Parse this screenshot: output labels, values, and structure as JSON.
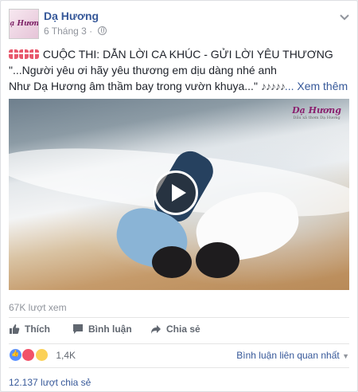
{
  "post": {
    "page_name": "Dạ Hương",
    "date": "6 Tháng 3 ·",
    "avatar_logo": "Dạ Hương",
    "line1": "CUỘC THI: DẪN LỜI CA KHÚC - GỬI LỜI YÊU THƯƠNG",
    "line2": "\"...Người yêu ơi hãy yêu thương em dịu dàng nhé anh",
    "line3": "Như Dạ Hương âm thầm bay trong vườn khuya...\"",
    "notes": "♪♪♪♪♪",
    "see_more": "... Xem thêm",
    "icons": [
      "gift-icon",
      "globe-icon",
      "chevron-down-icon",
      "play-icon",
      "like-icon",
      "comment-icon",
      "share-icon"
    ]
  },
  "media": {
    "logo": "Dạ Hương",
    "logo_sub": "Dầu xả thơm Dạ Hương"
  },
  "stats": {
    "views": "67K lượt xem",
    "reactions_count": "1,4K",
    "shares": "12.137 lượt chia sẻ"
  },
  "actions": {
    "like": "Thích",
    "comment": "Bình luận",
    "share": "Chia sẻ"
  },
  "comments": {
    "sort_label": "Bình luận liên quan nhất"
  },
  "colors": {
    "link": "#365899",
    "muted": "#90949c",
    "text": "#1d2129"
  }
}
